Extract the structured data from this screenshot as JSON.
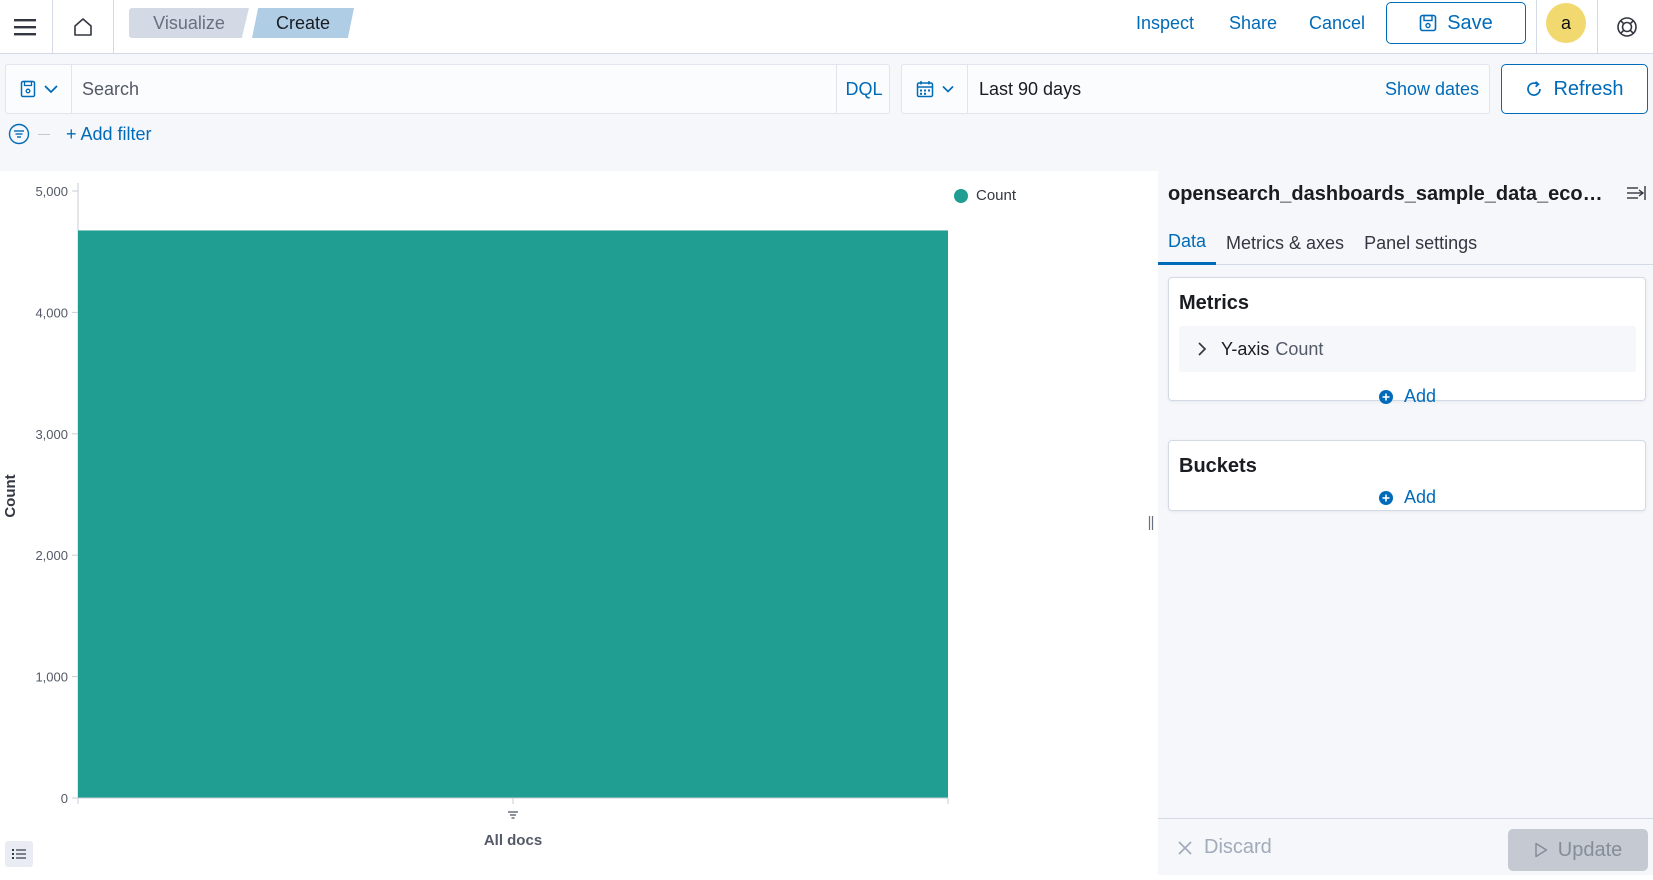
{
  "header": {
    "menu_icon": "hamburger-menu-icon",
    "home_icon": "home-icon",
    "breadcrumbs": [
      "Visualize",
      "Create"
    ],
    "links": {
      "inspect": "Inspect",
      "share": "Share",
      "cancel": "Cancel"
    },
    "save_label": "Save",
    "avatar_initial": "a",
    "help_icon": "help-lifebuoy-icon"
  },
  "query": {
    "search_placeholder": "Search",
    "language": "DQL",
    "date_range": "Last 90 days",
    "show_dates": "Show dates",
    "refresh_label": "Refresh",
    "add_filter": "+ Add filter"
  },
  "colors": {
    "accent": "#006bb8",
    "bar": "#209e91",
    "avatar": "#f1d86f"
  },
  "chart_data": {
    "type": "bar",
    "categories": [
      "All docs"
    ],
    "series": [
      {
        "name": "Count",
        "values": [
          4675
        ]
      }
    ],
    "ylabel": "Count",
    "xlabel": "",
    "ylim": [
      0,
      5000
    ],
    "yticks": [
      0,
      1000,
      2000,
      3000,
      4000,
      5000
    ],
    "ytick_labels": [
      "0",
      "1,000",
      "2,000",
      "3,000",
      "4,000",
      "5,000"
    ],
    "grid": false,
    "legend": "top-right"
  },
  "editor": {
    "index_title": "opensearch_dashboards_sample_data_ecom...",
    "tabs": [
      "Data",
      "Metrics & axes",
      "Panel settings"
    ],
    "metrics": {
      "title": "Metrics",
      "items": [
        {
          "name": "Y-axis",
          "type": "Count"
        }
      ],
      "add_label": "Add"
    },
    "buckets": {
      "title": "Buckets",
      "add_label": "Add"
    },
    "discard_label": "Discard",
    "update_label": "Update"
  }
}
